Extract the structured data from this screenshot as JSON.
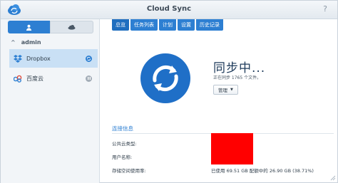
{
  "window": {
    "title": "Cloud Sync",
    "help_label": "?"
  },
  "sidebar": {
    "group_label": "admin",
    "items": [
      {
        "label": "Dropbox",
        "status": "syncing"
      },
      {
        "label": "百度云",
        "status": "paused"
      }
    ]
  },
  "tabs": [
    {
      "label": "总览"
    },
    {
      "label": "任务列表"
    },
    {
      "label": "计划"
    },
    {
      "label": "设置"
    },
    {
      "label": "历史记录"
    }
  ],
  "status": {
    "title": "同步中...",
    "subtitle": "正在同步 1765 个文件。",
    "manage_label": "管理"
  },
  "connection": {
    "section_title": "连接信息",
    "cloud_type_label": "公共云类型:",
    "username_label": "用户名称:",
    "storage_label": "存储空间使用率:",
    "storage_value": "已使用 69.51 GB 配额中的 26.90 GB (38.71%)"
  },
  "colors": {
    "accent": "#2d7fd2",
    "sync_icon": "#1f6fc7",
    "redacted": "#ff0000"
  }
}
